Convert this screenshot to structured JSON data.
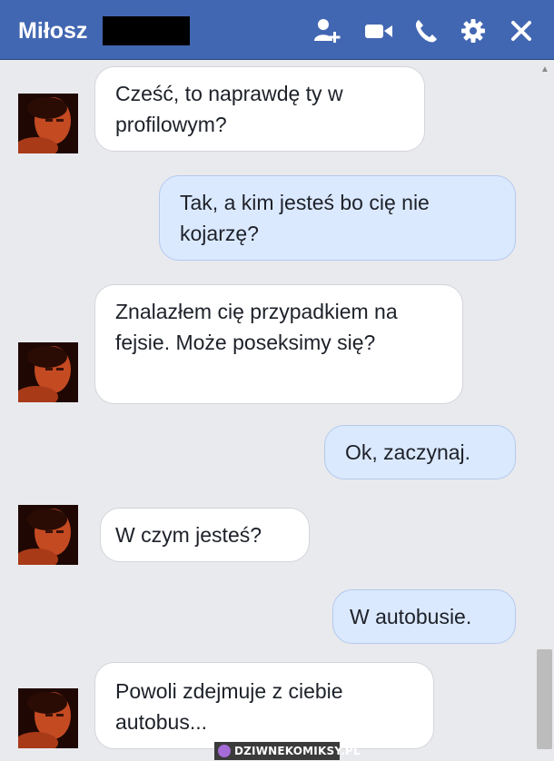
{
  "header": {
    "contact_name": "Miłosz",
    "bg_color": "#4267b2",
    "icons": [
      "add-friend-icon",
      "video-camera-icon",
      "phone-icon",
      "gear-icon",
      "close-icon"
    ]
  },
  "messages": [
    {
      "side": "in",
      "text": "Cześć, to naprawdę ty w profilowym?"
    },
    {
      "side": "out",
      "text": "Tak, a kim jesteś bo cię nie kojarzę?"
    },
    {
      "side": "in",
      "text": "Znalazłem cię przypadkiem na fejsie. Może poseksimy się?"
    },
    {
      "side": "out",
      "text": "Ok, zaczynaj."
    },
    {
      "side": "in",
      "text": "W czym jesteś?"
    },
    {
      "side": "out",
      "text": "W autobusie."
    },
    {
      "side": "in",
      "text": "Powoli zdejmuje z ciebie autobus..."
    }
  ],
  "watermark": "DZIWNEKOMIKSY.PL"
}
